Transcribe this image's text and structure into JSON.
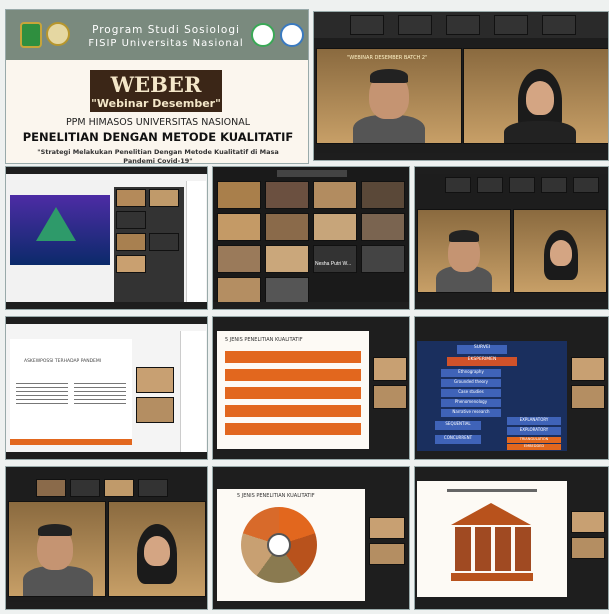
{
  "poster": {
    "program": "Program Studi Sosiologi",
    "faculty": "FISIP Universitas Nasional",
    "weber": "WEBER",
    "weber_sub": "\"Webinar Desember\"",
    "org": "PPM HIMASOS UNIVERSITAS NASIONAL",
    "title": "PENELITIAN DENGAN METODE KUALITATIF",
    "subtitle": "\"Strategi Melakukan Penelitian Dengan Metode Kualitatif di Masa Pandemi Covid-19\""
  },
  "banner_text": "\"WEBINAR DESEMBER BATCH 2\"",
  "slides": {
    "jenis_title": "5 JENIS PENELITIAN KUALITATIF",
    "paradigm_left": "ASKEWPOSSI TERHADAP PANDEMI",
    "method_items": [
      "SURVEI",
      "EKSPERIMEN",
      "Ethnography",
      "Grounded theory",
      "Case studies",
      "Phenomenology",
      "Narrative research"
    ],
    "method_right": [
      "EXPLANATORY",
      "EXPLORATORY",
      "TRIANGULATION",
      "EMBEDDED"
    ],
    "method_bottom": [
      "SEQUENTIAL",
      "CONCURRENT"
    ]
  },
  "zoom": {
    "participant": "Nesha Putri W...",
    "colors": {
      "accent": "#e2671e",
      "dark": "#1e1e1e"
    }
  }
}
